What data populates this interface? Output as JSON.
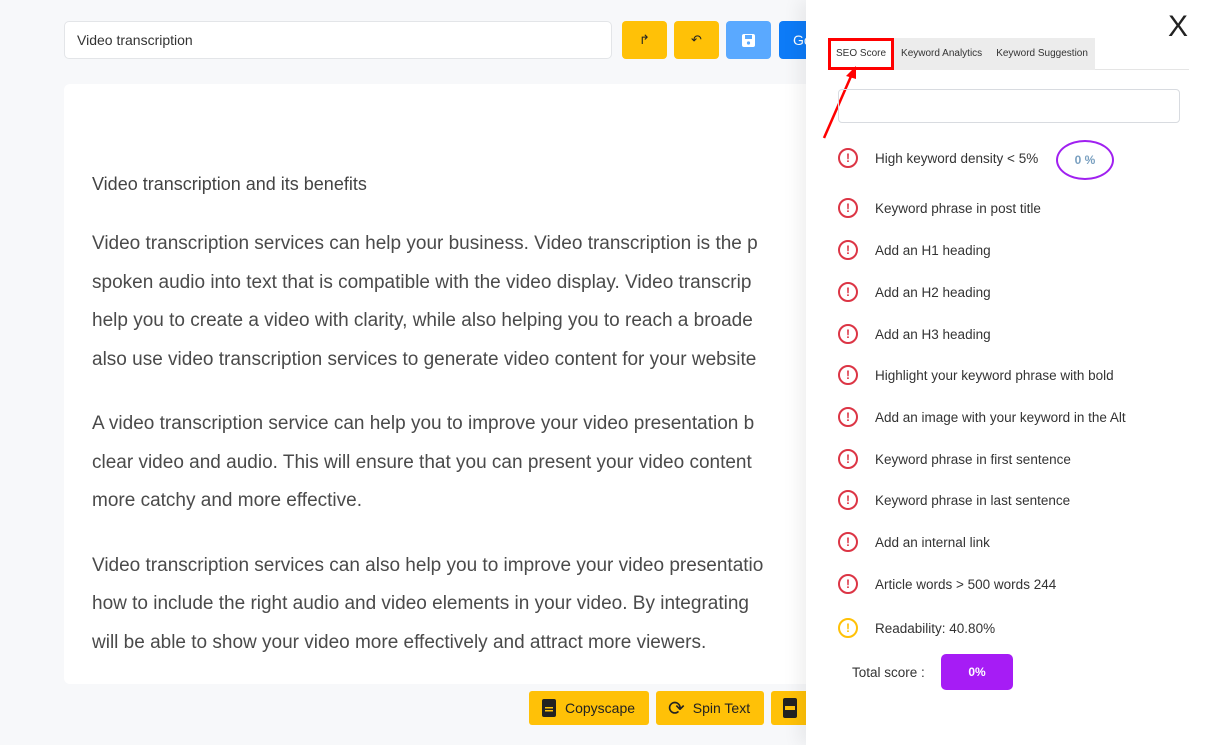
{
  "toolbar": {
    "title_value": "Video transcription",
    "redo_icon": "↱",
    "undo_icon": "↶",
    "save_icon": "save-icon",
    "go_label": "Go"
  },
  "editor": {
    "heading": "Video transcription and its benefits",
    "paragraphs": [
      [
        "Video transcription services can help your business. Video transcription is the p",
        "spoken audio into text that is compatible with the video display. Video transcrip",
        "help you to create a video with clarity, while also helping you to reach a broade",
        "also use video transcription services to generate video content for your website"
      ],
      [
        "A video transcription service can help you to improve your video presentation b",
        "clear video and audio. This will ensure that you can present your video content",
        "more catchy and more effective."
      ],
      [
        "Video transcription services can also help you to improve your video presentatio",
        "how to include the right audio and video elements in your video. By integrating",
        "will be able to show your video more effectively and attract more viewers."
      ]
    ]
  },
  "bottom_buttons": {
    "copyscape": "Copyscape",
    "spin": "Spin Text"
  },
  "panel": {
    "close": "X",
    "tabs": [
      "SEO Score",
      "Keyword Analytics",
      "Keyword Suggestion"
    ],
    "keyword_value": "",
    "density_value": "0 %",
    "checks": [
      "High keyword density < 5%",
      "Keyword phrase in post title",
      "Add an H1 heading",
      "Add an H2 heading",
      "Add an H3 heading",
      "Highlight your keyword phrase with bold",
      "Add an image with your keyword in the Alt",
      "Keyword phrase in first sentence",
      "Keyword phrase in last sentence",
      "Add an internal link",
      "Article words > 500 words 244",
      "Readability: 40.80%"
    ],
    "total_label": "Total score :",
    "total_value": "0%"
  },
  "colors": {
    "yellow": "#ffc107",
    "error": "#dc3545",
    "purple": "#a61cf5",
    "annotation": "#ff0000"
  }
}
